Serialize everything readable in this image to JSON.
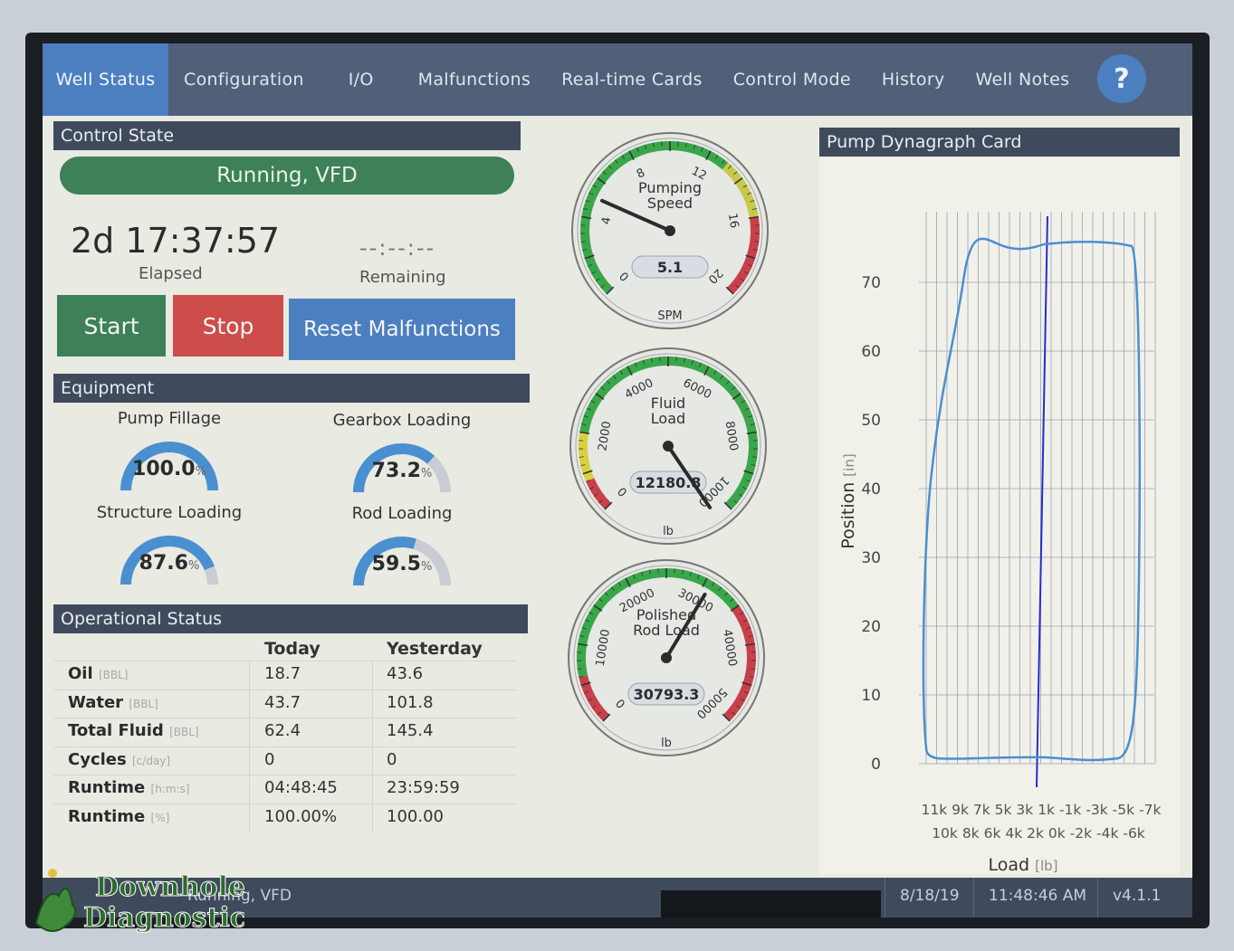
{
  "nav": {
    "tabs": [
      "Well Status",
      "Configuration",
      "I/O",
      "Malfunctions",
      "Real-time Cards",
      "Control Mode",
      "History",
      "Well Notes"
    ],
    "active": 0,
    "help": "?"
  },
  "control": {
    "header": "Control State",
    "state": "Running, VFD",
    "elapsed": "2d 17:37:57",
    "elapsed_label": "Elapsed",
    "remaining": "--:--:--",
    "remaining_label": "Remaining",
    "start": "Start",
    "stop": "Stop",
    "reset": "Reset Malfunctions"
  },
  "equipment": {
    "header": "Equipment",
    "pump_fillage": {
      "label": "Pump Fillage",
      "value": "100.0",
      "unit": "%",
      "fraction": 1.0
    },
    "gearbox": {
      "label": "Gearbox Loading",
      "value": "73.2",
      "unit": "%",
      "fraction": 0.732
    },
    "structure": {
      "label": "Structure Loading",
      "value": "87.6",
      "unit": "%",
      "fraction": 0.876
    },
    "rod": {
      "label": "Rod Loading",
      "value": "59.5",
      "unit": "%",
      "fraction": 0.595
    }
  },
  "ops": {
    "header": "Operational Status",
    "col_today": "Today",
    "col_yesterday": "Yesterday",
    "rows": [
      {
        "label": "Oil",
        "unit": "[BBL]",
        "today": "18.7",
        "yesterday": "43.6"
      },
      {
        "label": "Water",
        "unit": "[BBL]",
        "today": "43.7",
        "yesterday": "101.8"
      },
      {
        "label": "Total Fluid",
        "unit": "[BBL]",
        "today": "62.4",
        "yesterday": "145.4"
      },
      {
        "label": "Cycles",
        "unit": "[c/day]",
        "today": "0",
        "yesterday": "0"
      },
      {
        "label": "Runtime",
        "unit": "[h:m:s]",
        "today": "04:48:45",
        "yesterday": "23:59:59"
      },
      {
        "label": "Runtime",
        "unit": "[%]",
        "today": "100.00%",
        "yesterday": "100.00"
      }
    ]
  },
  "gauges": {
    "speed": {
      "title1": "Pumping",
      "title2": "Speed",
      "value": "5.1",
      "unit": "SPM",
      "min": 0,
      "max": 20,
      "reading": 5.1,
      "ticks": [
        "0",
        "4",
        "8",
        "12",
        "16",
        "20"
      ]
    },
    "fluid": {
      "title1": "Fluid",
      "title2": "Load",
      "value": "12180.8",
      "unit": "lb",
      "min": 0,
      "max": 10000,
      "reading": 12180.8,
      "ticks": [
        "0",
        "2000",
        "4000",
        "6000",
        "8000",
        "10000"
      ]
    },
    "polished": {
      "title1": "Polished",
      "title2": "Rod Load",
      "value": "30793.3",
      "unit": "lb",
      "min": 0,
      "max": 50000,
      "reading": 30793.3,
      "ticks": [
        "0",
        "10000",
        "20000",
        "30000",
        "40000",
        "50000"
      ]
    }
  },
  "dyna": {
    "header": "Pump Dynagraph Card",
    "ylabel": "Position",
    "ylabel_unit": "[in]",
    "xlabel": "Load",
    "xlabel_unit": "[lb]",
    "y_ticks": [
      "0",
      "10",
      "20",
      "30",
      "40",
      "50",
      "60",
      "70"
    ],
    "x_ticks_top": "11k 9k  7k  5k  3k  1k -1k -3k -5k -7k",
    "x_ticks_bottom": "10k 8k  6k  4k  2k  0k -2k -4k -6k"
  },
  "status_bar": {
    "state": "Running, VFD",
    "date": "8/18/19",
    "time": "11:48:46 AM",
    "version": "v4.1.1"
  },
  "logo": {
    "line1": "Downhole",
    "line2": "Diagnostic"
  },
  "colors": {
    "nav": "#515f79",
    "active": "#4b7fc0",
    "green": "#3e8057",
    "red": "#cc4d4a",
    "header": "#3f4a5d"
  }
}
